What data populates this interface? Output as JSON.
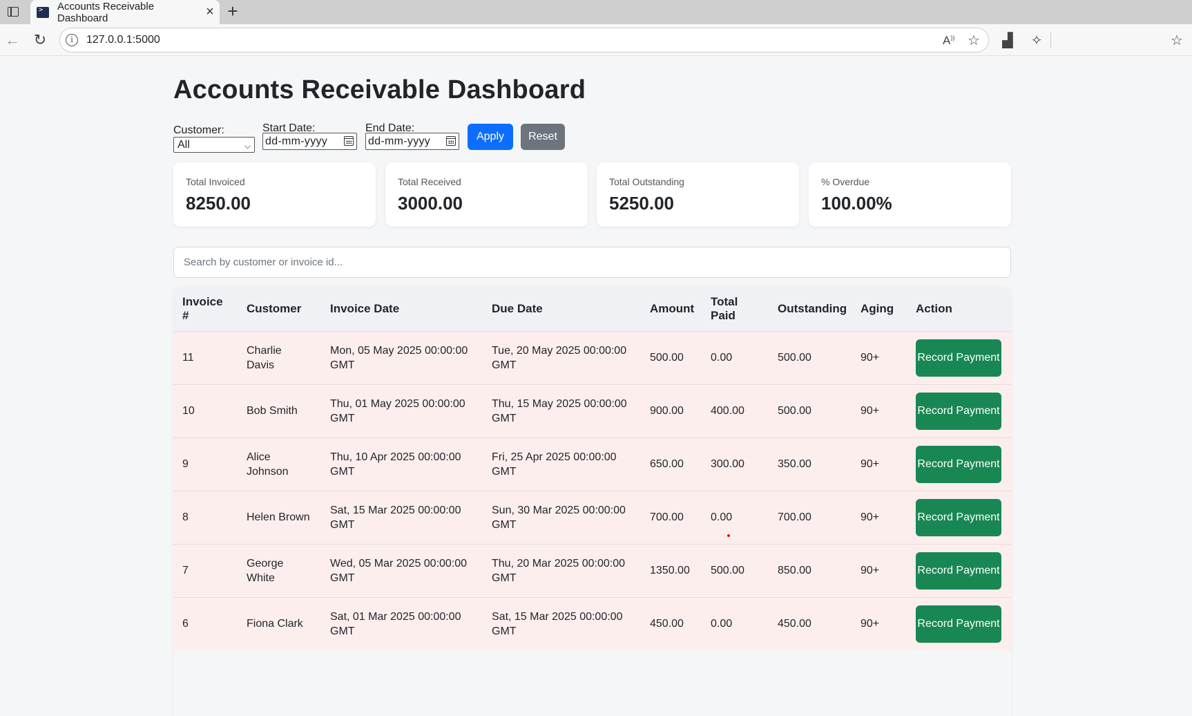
{
  "browser": {
    "tab_title": "Accounts Receivable Dashboard",
    "url": "127.0.0.1:5000"
  },
  "page": {
    "title": "Accounts Receivable Dashboard"
  },
  "filters": {
    "customer_label": "Customer:",
    "customer_value": "All",
    "start_label": "Start Date:",
    "start_value": "dd-mm-yyyy",
    "end_label": "End Date:",
    "end_value": "dd-mm-yyyy",
    "apply_label": "Apply",
    "reset_label": "Reset"
  },
  "summary": [
    {
      "label": "Total Invoiced",
      "value": "8250.00"
    },
    {
      "label": "Total Received",
      "value": "3000.00"
    },
    {
      "label": "Total Outstanding",
      "value": "5250.00"
    },
    {
      "label": "% Overdue",
      "value": "100.00%"
    }
  ],
  "search": {
    "placeholder": "Search by customer or invoice id..."
  },
  "table": {
    "headers": [
      "Invoice #",
      "Customer",
      "Invoice Date",
      "Due Date",
      "Amount",
      "Total Paid",
      "Outstanding",
      "Aging",
      "Action"
    ],
    "action_label": "Record Payment",
    "rows": [
      {
        "invoice": "11",
        "customer": "Charlie Davis",
        "invoice_date": "Mon, 05 May 2025 00:00:00 GMT",
        "due_date": "Tue, 20 May 2025 00:00:00 GMT",
        "amount": "500.00",
        "paid": "0.00",
        "outstanding": "500.00",
        "aging": "90+"
      },
      {
        "invoice": "10",
        "customer": "Bob Smith",
        "invoice_date": "Thu, 01 May 2025 00:00:00 GMT",
        "due_date": "Thu, 15 May 2025 00:00:00 GMT",
        "amount": "900.00",
        "paid": "400.00",
        "outstanding": "500.00",
        "aging": "90+"
      },
      {
        "invoice": "9",
        "customer": "Alice Johnson",
        "invoice_date": "Thu, 10 Apr 2025 00:00:00 GMT",
        "due_date": "Fri, 25 Apr 2025 00:00:00 GMT",
        "amount": "650.00",
        "paid": "300.00",
        "outstanding": "350.00",
        "aging": "90+"
      },
      {
        "invoice": "8",
        "customer": "Helen Brown",
        "invoice_date": "Sat, 15 Mar 2025 00:00:00 GMT",
        "due_date": "Sun, 30 Mar 2025 00:00:00 GMT",
        "amount": "700.00",
        "paid": "0.00",
        "outstanding": "700.00",
        "aging": "90+"
      },
      {
        "invoice": "7",
        "customer": "George White",
        "invoice_date": "Wed, 05 Mar 2025 00:00:00 GMT",
        "due_date": "Thu, 20 Mar 2025 00:00:00 GMT",
        "amount": "1350.00",
        "paid": "500.00",
        "outstanding": "850.00",
        "aging": "90+"
      },
      {
        "invoice": "6",
        "customer": "Fiona Clark",
        "invoice_date": "Sat, 01 Mar 2025 00:00:00 GMT",
        "due_date": "Sat, 15 Mar 2025 00:00:00 GMT",
        "amount": "450.00",
        "paid": "0.00",
        "outstanding": "450.00",
        "aging": "90+"
      }
    ]
  },
  "colors": {
    "primary": "#0d6efd",
    "secondary": "#6c757d",
    "success": "#198754",
    "overdue_row": "#fdeeee"
  }
}
